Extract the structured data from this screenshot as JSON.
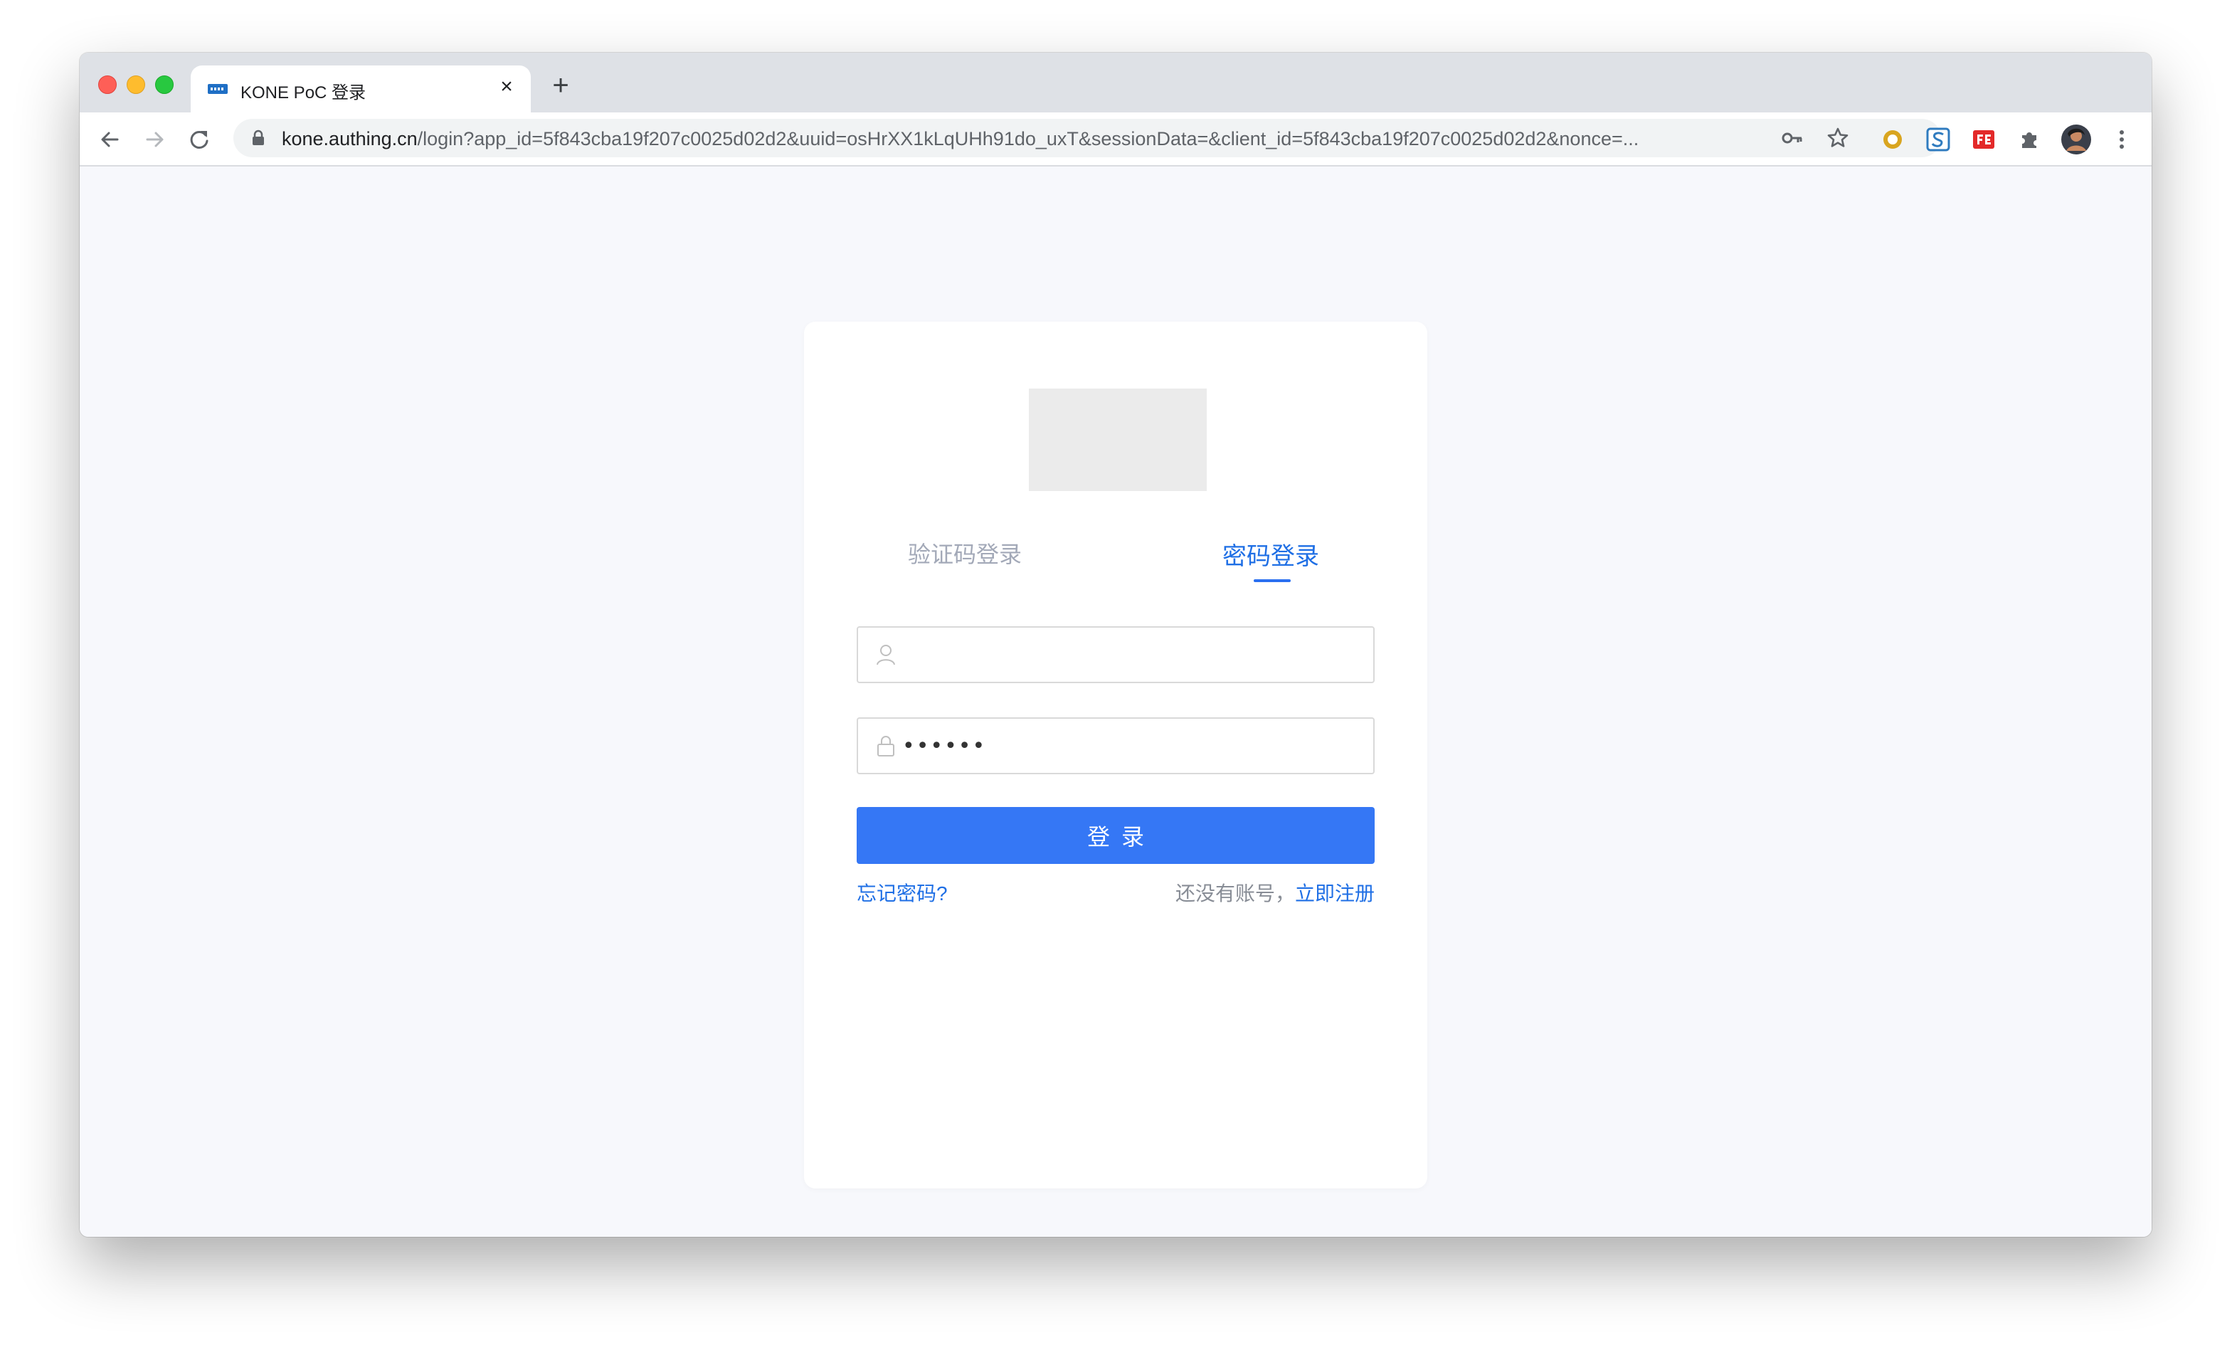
{
  "browser": {
    "tab": {
      "title": "KONE PoC 登录",
      "close_label": "×"
    },
    "new_tab_label": "+",
    "url": {
      "host": "kone.authing.cn",
      "path": "/login?app_id=5f843cba19f207c0025d02d2&uuid=osHrXX1kLqUHh91do_uxT&sessionData=&client_id=5f843cba19f207c0025d02d2&nonce=..."
    },
    "icons": [
      "back-icon",
      "forward-icon",
      "reload-icon",
      "lock-icon",
      "key-icon",
      "star-icon",
      "extension-ring-icon",
      "extension-s-icon",
      "extension-fe-icon",
      "puzzle-icon",
      "profile-avatar",
      "menu-dots-icon"
    ]
  },
  "login": {
    "tabs": {
      "code": "验证码登录",
      "password": "密码登录"
    },
    "active_tab": "password",
    "username": {
      "value": "",
      "placeholder": ""
    },
    "password": {
      "value": "••••••"
    },
    "submit_label": "登录",
    "forgot_label": "忘记密码?",
    "signup_hint": "还没有账号，",
    "signup_link": "立即注册"
  },
  "colors": {
    "accent": "#3577f5",
    "link": "#1f6fe5",
    "page_bg": "#f7f8fc"
  }
}
